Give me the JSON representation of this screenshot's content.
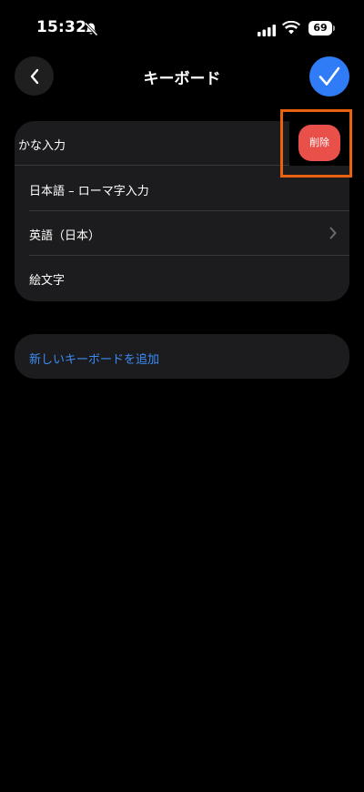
{
  "status_bar": {
    "time": "15:32",
    "battery_level": "69",
    "icons": [
      "bell-slash-icon",
      "cellular-signal-icon",
      "wifi-icon",
      "battery-icon"
    ]
  },
  "nav": {
    "title": "キーボード",
    "back_icon": "chevron-left-icon",
    "done_icon": "checkmark-icon"
  },
  "keyboards": [
    {
      "label": "かな入力",
      "state": "swiped-to-delete"
    },
    {
      "label": "日本語 – ローマ字入力"
    },
    {
      "label": "英語（日本）",
      "has_chevron": true
    },
    {
      "label": "絵文字"
    }
  ],
  "delete_action": {
    "label": "削除"
  },
  "add_keyboard": {
    "label": "新しいキーボードを追加"
  },
  "colors": {
    "background": "#000000",
    "card": "#1c1c1e",
    "accent_blue": "#2f7cf6",
    "link_blue": "#3a8cf5",
    "delete_red": "#e9504a",
    "highlight_orange": "#e8620f"
  }
}
